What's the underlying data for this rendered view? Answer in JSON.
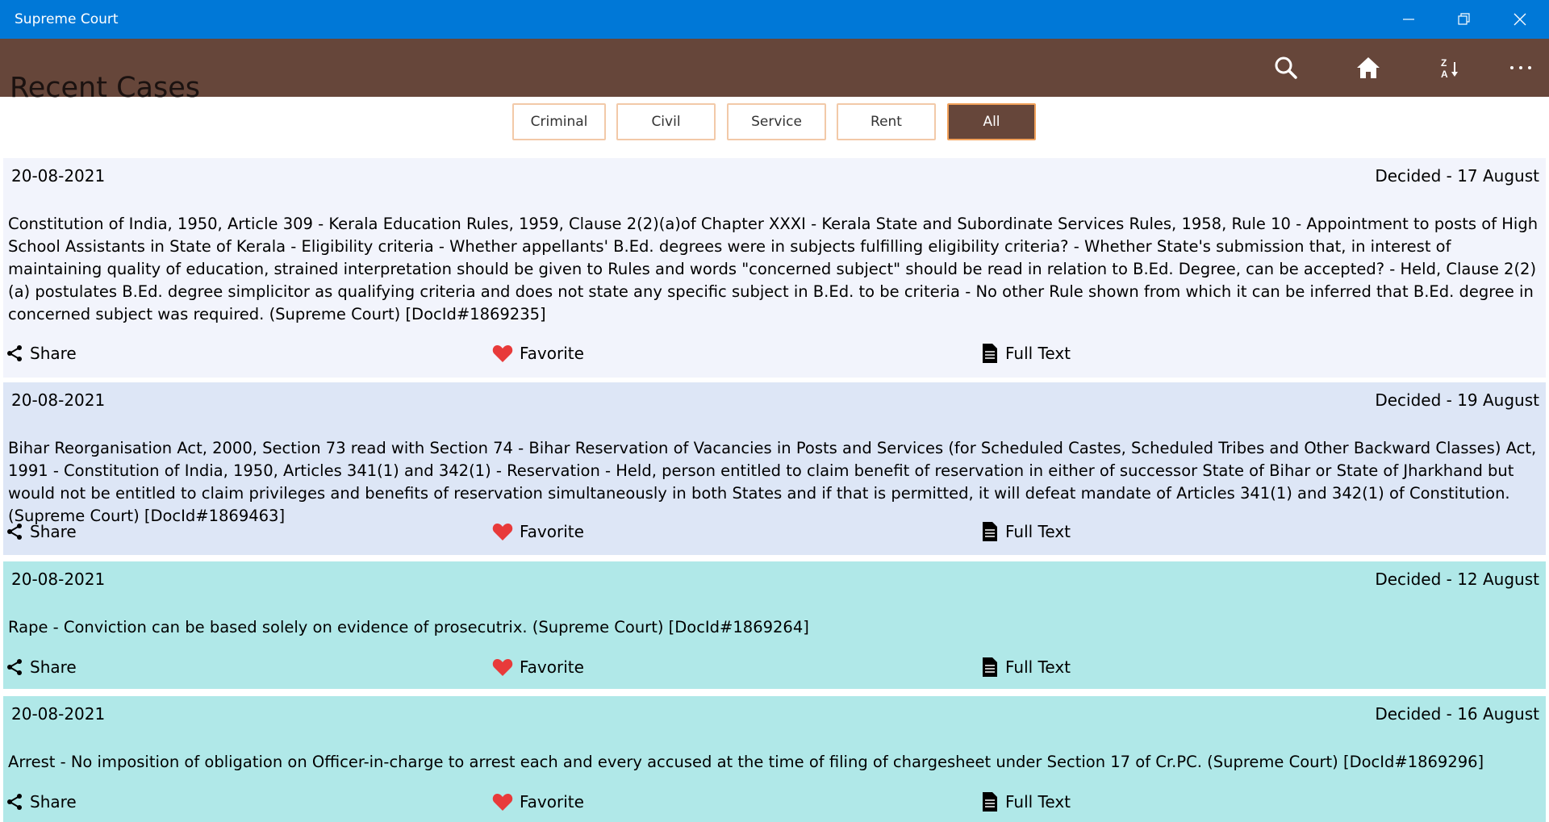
{
  "window": {
    "title": "Supreme Court"
  },
  "header": {
    "title": "Recent Cases",
    "icons": [
      "search-icon",
      "home-icon",
      "sort-z-a-icon",
      "more-icon"
    ]
  },
  "filters": [
    {
      "label": "Criminal",
      "active": false
    },
    {
      "label": "Civil",
      "active": false
    },
    {
      "label": "Service",
      "active": false
    },
    {
      "label": "Rent",
      "active": false
    },
    {
      "label": "All",
      "active": true
    }
  ],
  "actions": {
    "share": "Share",
    "favorite": "Favorite",
    "full_text": "Full Text"
  },
  "colors": {
    "titlebar": "#0078d7",
    "appbar": "#66463a",
    "card_1": "#f2f4fc",
    "card_2": "#dde6f6",
    "card_3": "#b0e8e8",
    "card_4": "#b0e8e8",
    "favorite": "#e83a3a"
  },
  "cases": [
    {
      "date": "20-08-2021",
      "decided": "Decided - 17 August",
      "summary": "Constitution of India, 1950, Article 309 - Kerala Education Rules, 1959, Clause 2(2)(a)of Chapter XXXI - Kerala State and Subordinate Services Rules, 1958, Rule 10 - Appointment to posts of High School Assistants in State of Kerala - Eligibility criteria - Whether appellants' B.Ed. degrees were in subjects fulfilling eligibility criteria? - Whether State's submission that, in interest of maintaining quality of education, strained interpretation should be given to Rules and words \"concerned subject\" should be read in relation to B.Ed. Degree, can be accepted? - Held, Clause 2(2)(a) postulates B.Ed. degree simplicitor as qualifying criteria and does not state any specific subject in B.Ed. to be criteria - No other Rule shown from which it can be inferred that B.Ed. degree in concerned subject was required. (Supreme Court) [DocId#1869235]"
    },
    {
      "date": "20-08-2021",
      "decided": "Decided - 19 August",
      "summary": "Bihar Reorganisation Act, 2000, Section 73 read with Section 74 - Bihar Reservation of Vacancies in Posts and Services (for Scheduled Castes, Scheduled Tribes and Other Backward Classes) Act, 1991 - Constitution of India, 1950, Articles 341(1) and 342(1) - Reservation - Held, person entitled to claim benefit of reservation in either of successor State of Bihar or State of Jharkhand but would not be entitled to claim privileges and benefits of reservation simultaneously in both States and if that is permitted, it will defeat mandate of Articles 341(1) and 342(1) of Constitution. (Supreme Court) [DocId#1869463]"
    },
    {
      "date": "20-08-2021",
      "decided": "Decided - 12 August",
      "summary": "Rape - Conviction can be based solely on evidence of prosecutrix. (Supreme Court) [DocId#1869264]"
    },
    {
      "date": "20-08-2021",
      "decided": "Decided - 16 August",
      "summary": "Arrest - No imposition of obligation on Officer-in-charge to arrest each and every accused at the time of filing of chargesheet under Section 17 of Cr.PC. (Supreme Court) [DocId#1869296]"
    }
  ]
}
